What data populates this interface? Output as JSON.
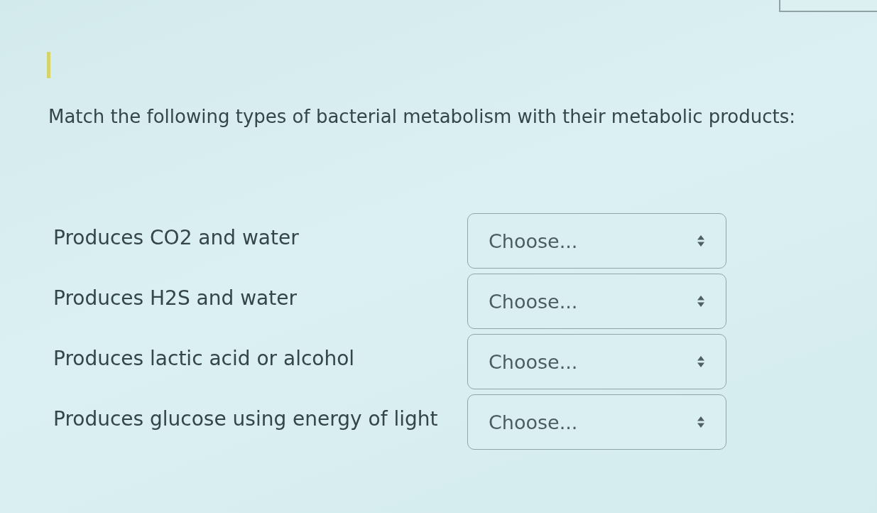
{
  "question": "Match the following types of bacterial metabolism with their metabolic products:",
  "items": [
    {
      "label": "Produces CO2 and water",
      "select": {
        "value": "Choose..."
      }
    },
    {
      "label": "Produces H2S and water",
      "select": {
        "value": "Choose..."
      }
    },
    {
      "label": "Produces lactic acid or alcohol",
      "select": {
        "value": "Choose..."
      }
    },
    {
      "label": "Produces glucose using energy of light",
      "select": {
        "value": "Choose..."
      }
    }
  ]
}
